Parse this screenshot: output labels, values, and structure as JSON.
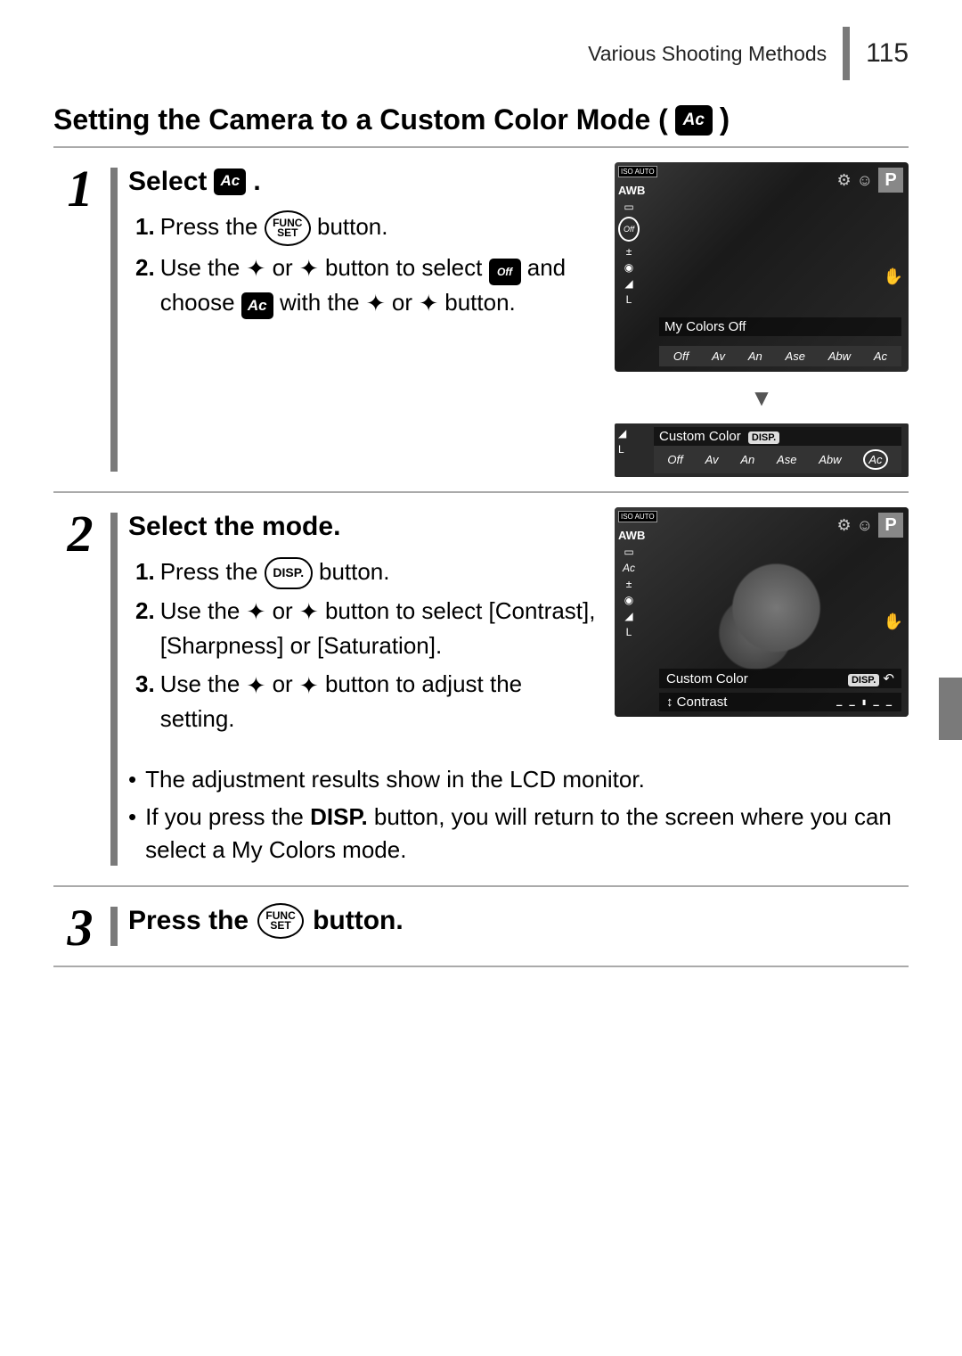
{
  "header": {
    "section": "Various Shooting Methods",
    "page": "115"
  },
  "title": {
    "text": "Setting the Camera to a Custom Color Mode (",
    "close": ")",
    "icon_label": "Ac"
  },
  "steps": {
    "s1": {
      "num": "1",
      "heading_prefix": "Select",
      "heading_suffix": ".",
      "icon_label": "Ac",
      "item1_num": "1.",
      "item1_a": "Press the",
      "item1_btn": "FUNC SET",
      "item1_b": "button.",
      "item2_num": "2.",
      "item2_a": "Use the",
      "item2_or": "or",
      "item2_b": "button to select",
      "item2_c": "and choose",
      "item2_with": "with the",
      "item2_or2": "or",
      "item2_end": "button.",
      "off_icon": "Off",
      "ac_icon": "Ac",
      "screen1": {
        "label": "My Colors Off",
        "opts": [
          "Off",
          "Av",
          "An",
          "Ase",
          "Abw",
          "Ac"
        ]
      },
      "screen2": {
        "label": "Custom Color",
        "disp": "DISP.",
        "opts": [
          "Off",
          "Av",
          "An",
          "Ase",
          "Abw",
          "Ac"
        ]
      }
    },
    "s2": {
      "num": "2",
      "heading": "Select the mode.",
      "item1_num": "1.",
      "item1_a": "Press the",
      "item1_btn": "DISP.",
      "item1_b": "button.",
      "item2_num": "2.",
      "item2_a": "Use the",
      "item2_or": "or",
      "item2_b": "button to select [Contrast], [Sharpness] or [Saturation].",
      "item3_num": "3.",
      "item3_a": "Use the",
      "item3_or": "or",
      "item3_b": "button to adjust the setting.",
      "bullet1": "The adjustment results show in the LCD monitor.",
      "bullet2_a": "If you press the",
      "bullet2_disp": "DISP.",
      "bullet2_b": "button, you will return to the screen where you can select a My Colors mode.",
      "screen": {
        "cc": "Custom Color",
        "disp": "DISP.",
        "contrast_label": "Contrast"
      }
    },
    "s3": {
      "num": "3",
      "heading_a": "Press the",
      "btn": "FUNC SET",
      "heading_b": "button."
    }
  },
  "cam_common": {
    "iso": "ISO AUTO",
    "awb": "AWB",
    "p": "P",
    "l": "L",
    "updown": "↕"
  }
}
